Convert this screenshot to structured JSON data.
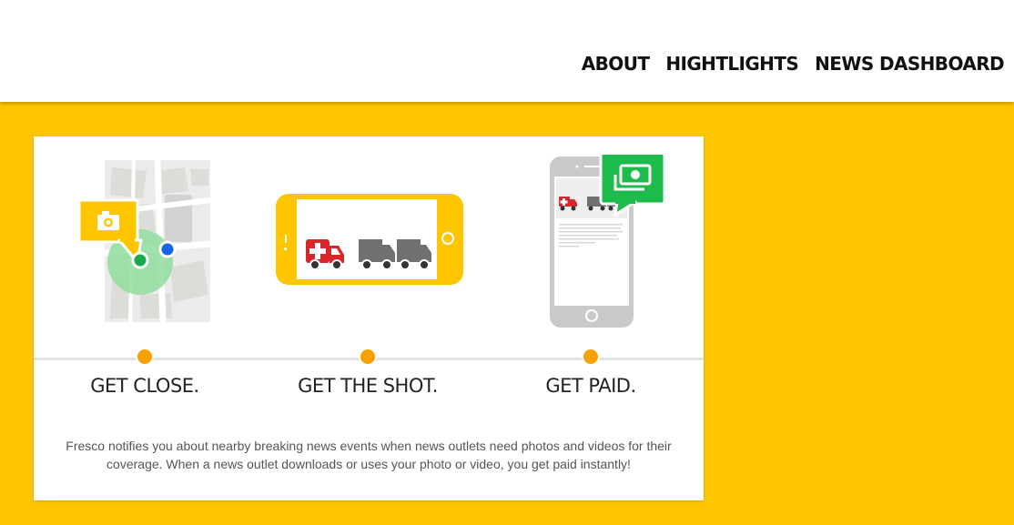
{
  "nav": {
    "items": [
      {
        "label": "ABOUT"
      },
      {
        "label": "HIGHTLIGHTS"
      },
      {
        "label": "NEWS DASHBOARD"
      }
    ]
  },
  "steps": [
    {
      "label": "GET CLOSE.",
      "icon": "map-location-icon"
    },
    {
      "label": "GET THE SHOT.",
      "icon": "phone-landscape-camera-icon"
    },
    {
      "label": "GET PAID.",
      "icon": "phone-payment-icon"
    }
  ],
  "description": "Fresco notifies you about nearby breaking news events when news outlets need photos and videos for their coverage. When a news outlet downloads or uses your photo or video, you get paid instantly!",
  "colors": {
    "brand_yellow": "#FFC600",
    "accent_orange": "#F5A200",
    "money_green": "#1DBB4B",
    "location_blue": "#1565E8"
  }
}
